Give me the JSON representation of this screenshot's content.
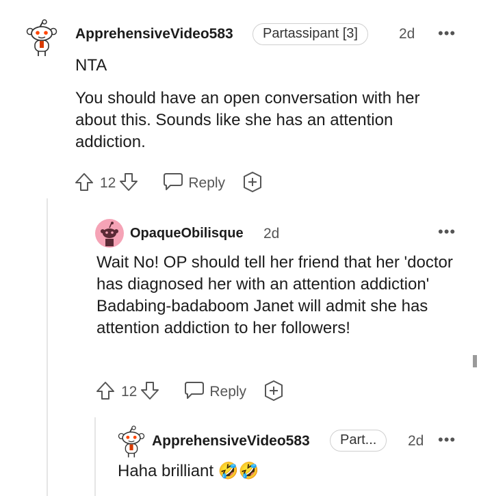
{
  "comments": [
    {
      "username": "ApprehensiveVideo583",
      "flair": "Partassipant [3]",
      "time": "2d",
      "more": "•••",
      "paragraphs": [
        "NTA",
        "You should have an open conversation with her about this. Sounds like she has an attention addiction."
      ],
      "votes": "12",
      "reply_label": "Reply"
    },
    {
      "username": "OpaqueObilisque",
      "time": "2d",
      "more": "•••",
      "paragraphs": [
        "Wait No! OP should tell her friend that her 'doctor has diagnosed her with an attention addiction' Badabing-badaboom Janet will admit she has attention addiction to her followers!"
      ],
      "votes": "12",
      "reply_label": "Reply"
    },
    {
      "username": "ApprehensiveVideo583",
      "flair": "Part...",
      "time": "2d",
      "more": "•••",
      "paragraphs": [
        "Haha brilliant 🤣🤣"
      ]
    }
  ],
  "colors": {
    "avatar_pink": "#f5a3b6",
    "thread_line": "#e5e5e5",
    "text_muted": "#555555"
  }
}
